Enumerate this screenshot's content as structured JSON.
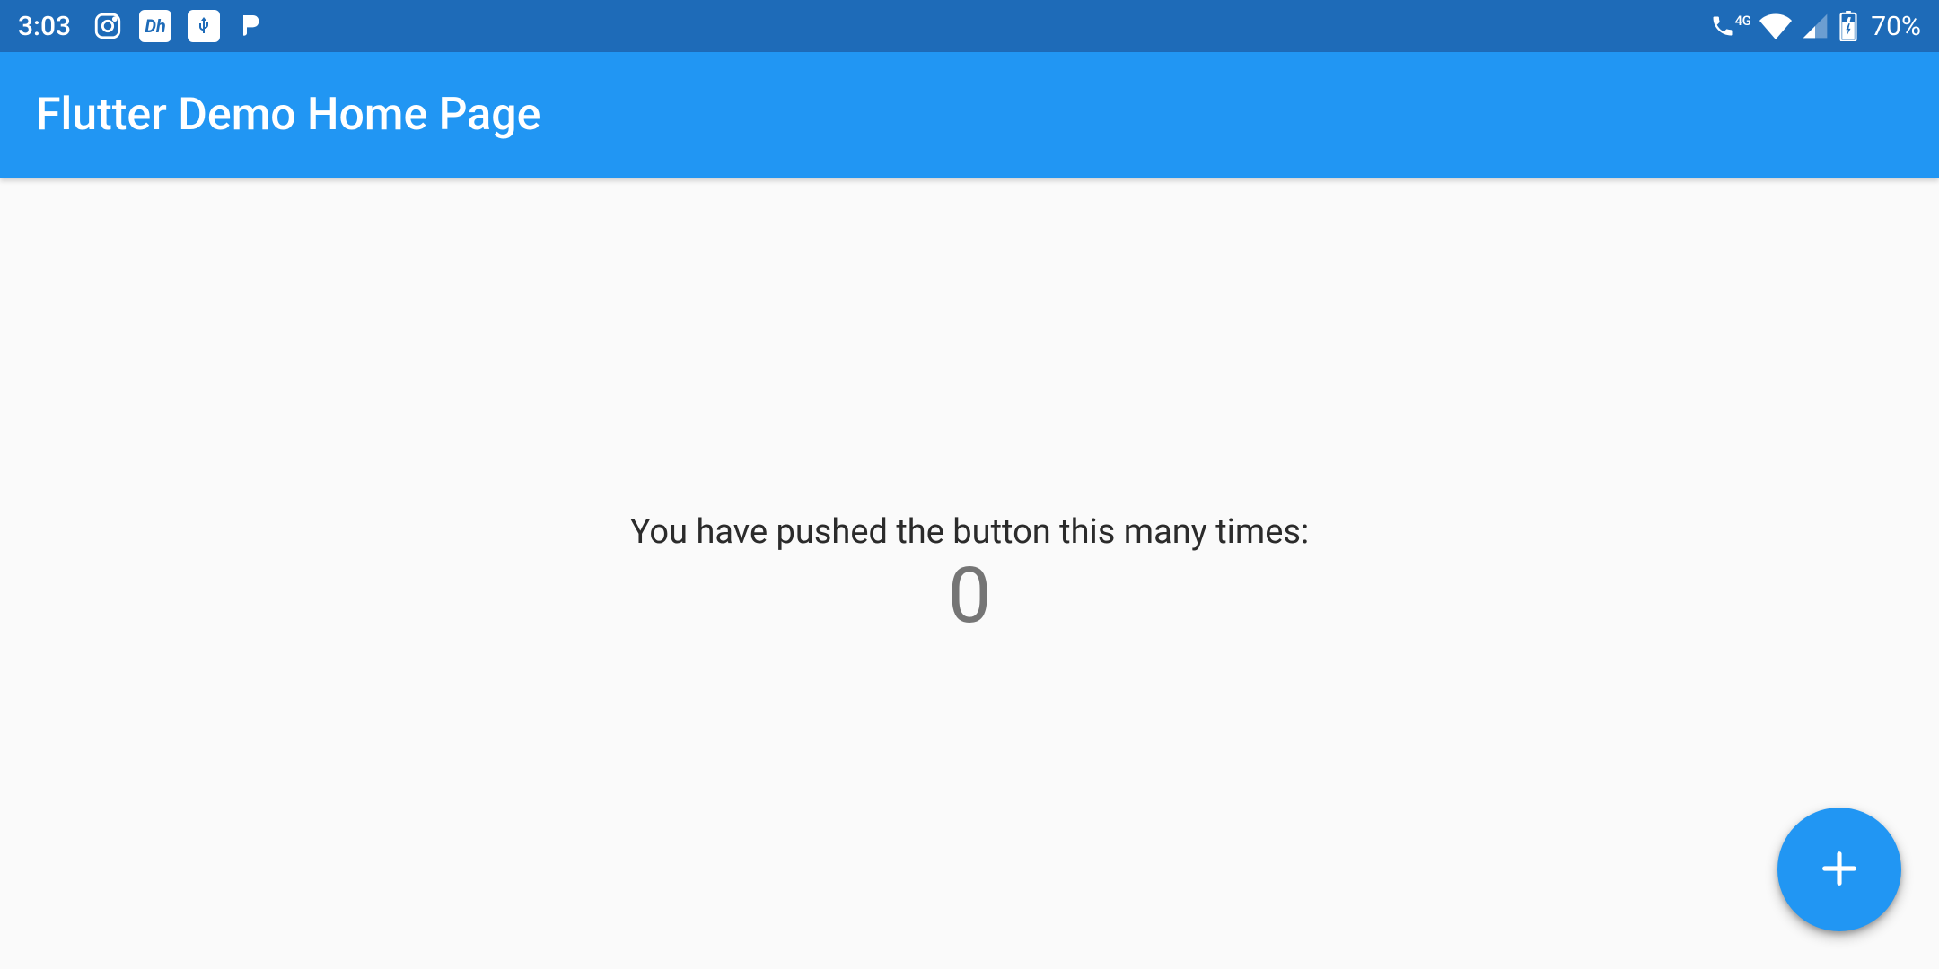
{
  "status_bar": {
    "time": "3:03",
    "network_label": "4G",
    "battery_percent": "70%"
  },
  "app_bar": {
    "title": "Flutter Demo Home Page"
  },
  "body": {
    "push_text": "You have pushed the button this many times:",
    "counter": "0"
  },
  "fab": {
    "icon": "plus-icon"
  },
  "colors": {
    "status_bar": "#1e6bb8",
    "app_bar": "#2196f3",
    "fab": "#2196f3",
    "background": "#fafafa"
  }
}
